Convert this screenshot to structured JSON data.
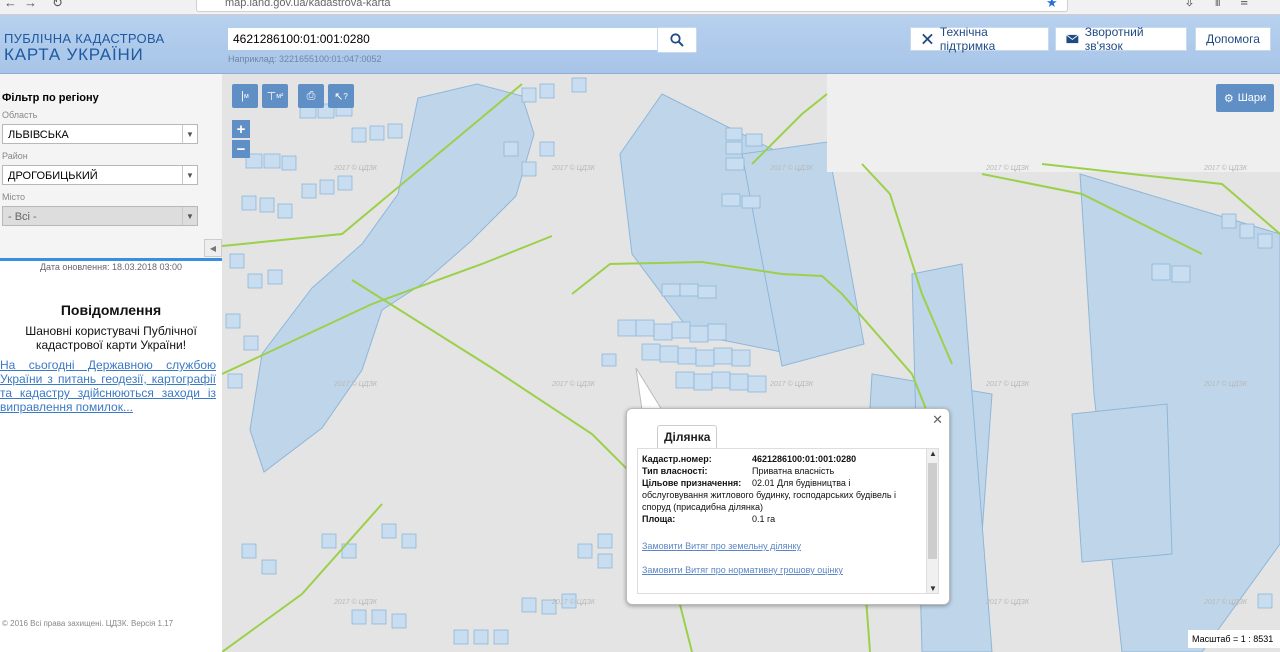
{
  "browser": {
    "url": "map.land.gov.ua/kadastrova-karta"
  },
  "header": {
    "logo_line1": "ПУБЛІЧНА КАДАСТРОВА",
    "logo_line2": "КАРТА УКРАЇНИ",
    "search_value": "4621286100:01:001:0280",
    "example": "Наприклад: 3221655100:01:047:0052",
    "support_label": "Технічна підтримка",
    "feedback_label": "Зворотний зв'язок",
    "help_label": "Допомога"
  },
  "sidebar": {
    "filter_title": "Фільтр по регіону",
    "oblast_label": "Область",
    "oblast_value": "ЛЬВІВСЬКА",
    "rayon_label": "Район",
    "rayon_value": "ДРОГОБИЦЬКИЙ",
    "city_label": "Місто",
    "city_value": "- Всі -",
    "update_date": "Дата оновлення: 18.03.2018 03:00",
    "messages_title": "Повідомлення",
    "messages_text": "Шановні користувачі Публічної кадастрової карти України!",
    "messages_link": "На сьогодні Державною службою України з питань геодезії, картографії та кадастру здійснюються заходи із виправлення помилок...",
    "copyright": "© 2016 Всі права захищені. ЦДЗК. Версія 1.17"
  },
  "map": {
    "layers_label": "Шари",
    "scale_label": "Масштаб = 1 : 8531",
    "watermark": "2017 © ЦДЗК"
  },
  "popup": {
    "tab": "Ділянка",
    "cadastral_key": "Кадастр.номер:",
    "cadastral_val": "4621286100:01:001:0280",
    "ownership_key": "Тип власності:",
    "ownership_val": "Приватна власність",
    "purpose_key": "Цільове призначення:",
    "purpose_val1": "02.01 Для будівництва і",
    "purpose_val2": "обслуговування житлового будинку, господарських будівель і",
    "purpose_val3": "споруд (присадибна ділянка)",
    "area_key": "Площа:",
    "area_val": "0.1 га",
    "link1": "Замовити Витяг про земельну ділянку",
    "link2": "Замовити Витяг про нормативну грошову оцінку"
  }
}
